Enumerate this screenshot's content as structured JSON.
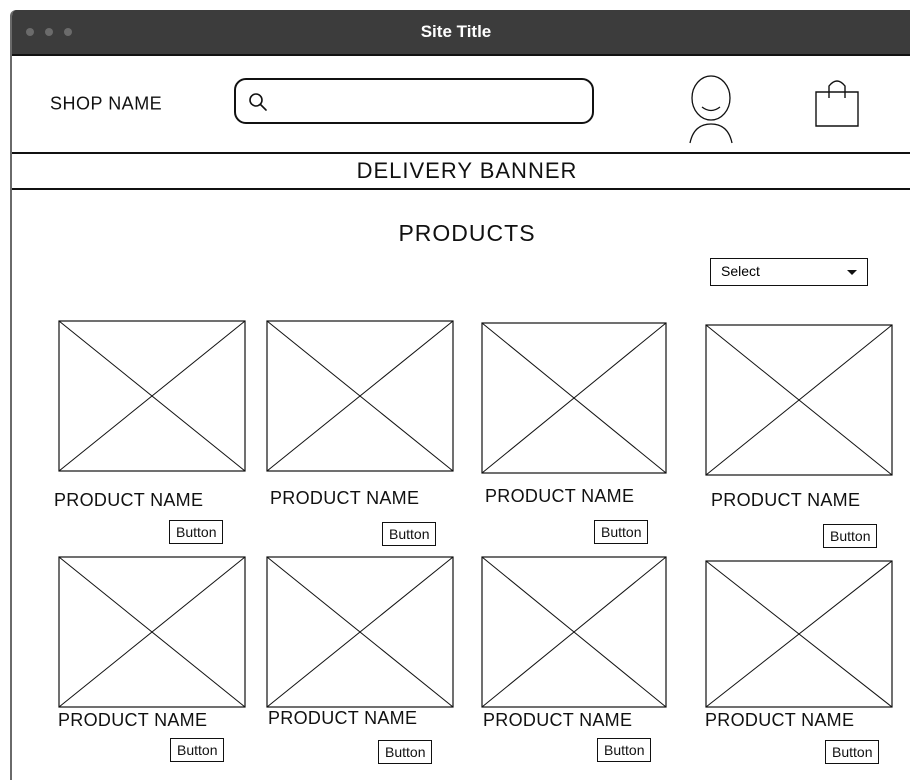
{
  "window": {
    "title": "Site Title"
  },
  "header": {
    "shop_name": "SHOP NAME",
    "search": {
      "value": "",
      "placeholder": ""
    },
    "icons": [
      "search-icon",
      "user-icon",
      "shopping-bag-icon"
    ]
  },
  "banner": {
    "text": "DELIVERY BANNER"
  },
  "products": {
    "title": "PRODUCTS",
    "sort_select": {
      "value": "Select"
    },
    "items": [
      {
        "name": "PRODUCT NAME",
        "button": "Button"
      },
      {
        "name": "PRODUCT NAME",
        "button": "Button"
      },
      {
        "name": "PRODUCT NAME",
        "button": "Button"
      },
      {
        "name": "PRODUCT NAME",
        "button": "Button"
      },
      {
        "name": "PRODUCT NAME",
        "button": "Button"
      },
      {
        "name": "PRODUCT NAME",
        "button": "Button"
      },
      {
        "name": "PRODUCT NAME",
        "button": "Button"
      },
      {
        "name": "PRODUCT NAME",
        "button": "Button"
      }
    ]
  }
}
